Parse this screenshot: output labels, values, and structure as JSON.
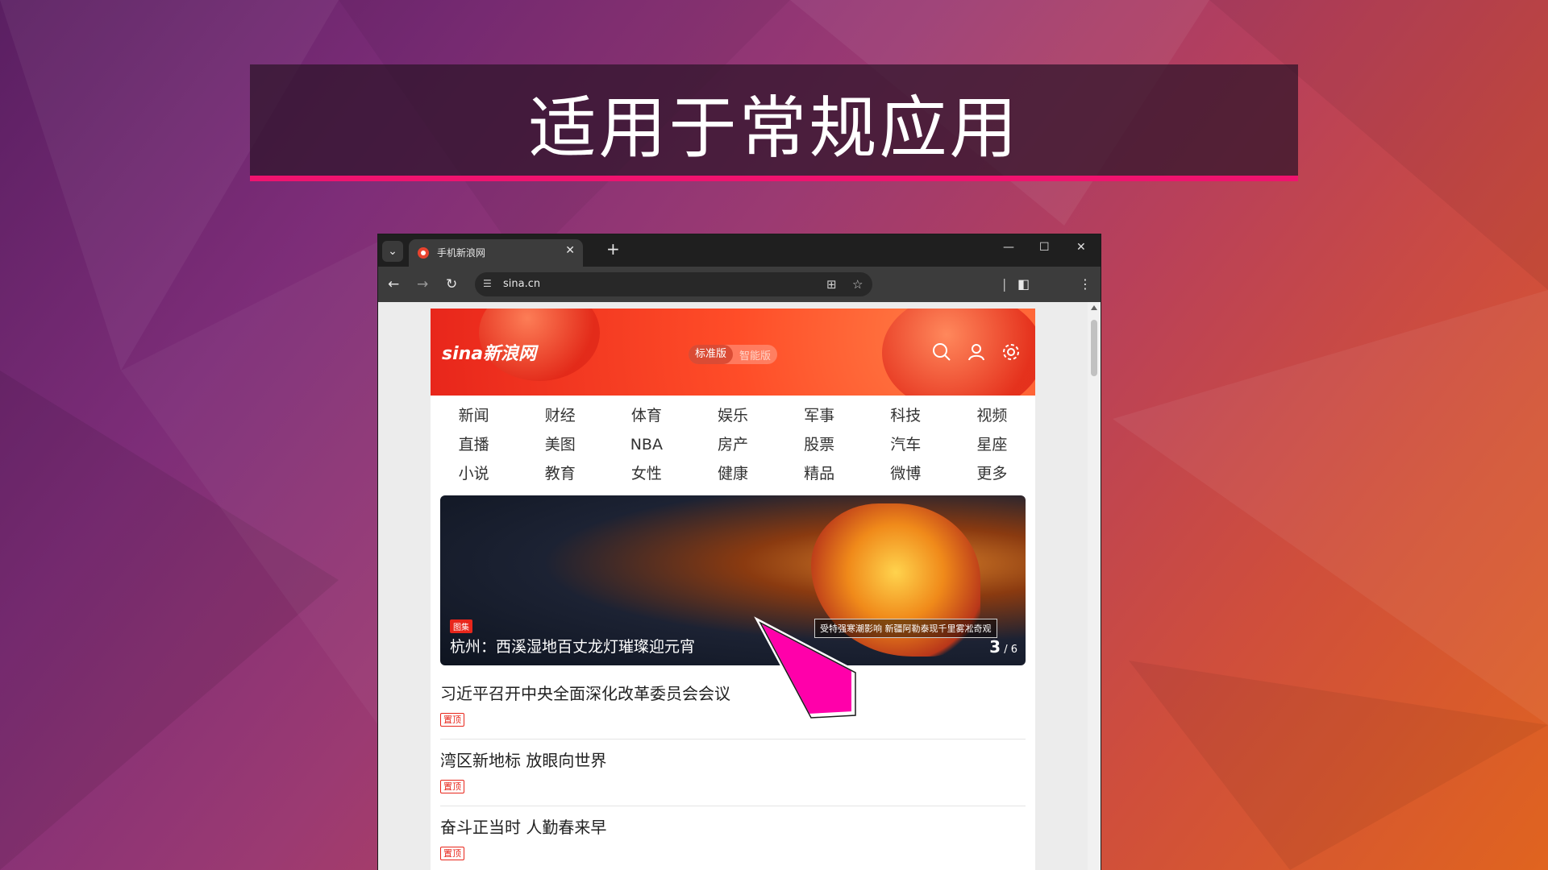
{
  "slide": {
    "title": "适用于常规应用"
  },
  "browser": {
    "tab_title": "手机新浪网",
    "url": "sina.cn",
    "icons": {
      "tab_menu": "chevron-down-icon",
      "close_tab": "close-icon",
      "new_tab": "plus-icon",
      "minimize": "minimize-icon",
      "maximize": "maximize-icon",
      "close_window": "close-icon",
      "back": "arrow-left-icon",
      "forward": "arrow-right-icon",
      "reload": "reload-icon",
      "site_info": "tune-icon",
      "translate": "translate-icon",
      "bookmark": "star-icon",
      "side_panel": "side-panel-icon",
      "menu": "more-vert-icon"
    }
  },
  "sina": {
    "logo": "sina新浪网",
    "mode_standard": "标准版",
    "mode_smart": "智能版",
    "channels": [
      "新闻",
      "财经",
      "体育",
      "娱乐",
      "军事",
      "科技",
      "视频",
      "直播",
      "美图",
      "NBA",
      "房产",
      "股票",
      "汽车",
      "星座",
      "小说",
      "教育",
      "女性",
      "健康",
      "精品",
      "微博",
      "更多"
    ],
    "hero": {
      "tag": "图集",
      "title": "杭州：西溪湿地百丈龙灯璀璨迎元宵",
      "caption": "受特强寒潮影响 新疆阿勒泰现千里雾凇奇观",
      "current": "3",
      "total": "/ 6"
    },
    "news": [
      {
        "title": "习近平召开中央全面深化改革委员会会议",
        "badge": "置顶"
      },
      {
        "title": "湾区新地标 放眼向世界",
        "badge": "置顶"
      },
      {
        "title": "奋斗正当时 人勤春来早",
        "badge": "置顶"
      }
    ]
  },
  "colors": {
    "accent_bar": "#f0136f",
    "sina_red": "#e8261b",
    "pointer": "#ff00aa"
  }
}
